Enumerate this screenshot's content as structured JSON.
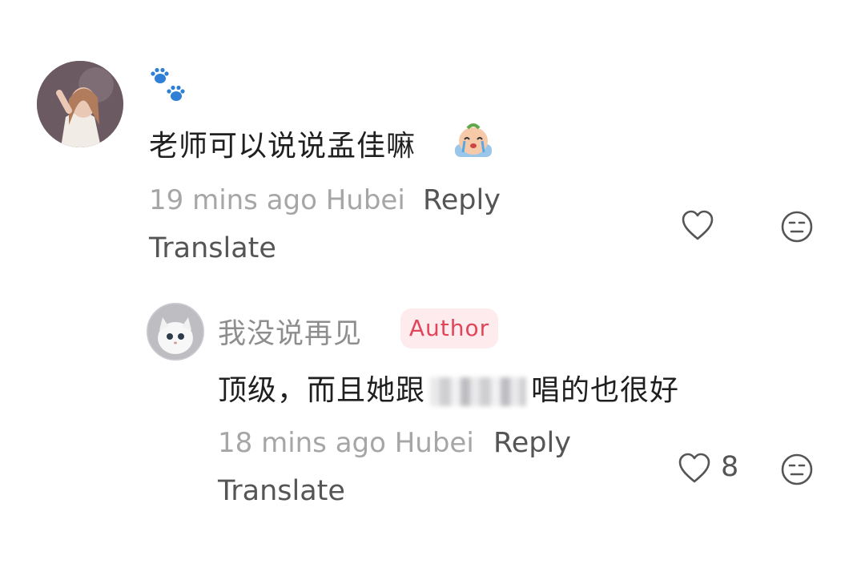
{
  "comments": [
    {
      "username": "🐾",
      "text": "老师可以说说孟佳嘛",
      "time_location": "19 mins ago Hubei",
      "reply_label": "Reply",
      "translate_label": "Translate",
      "like_count": "",
      "icons": {
        "like": "heart-icon",
        "react": "emoji-reaction-icon",
        "emoji": "crying-emoji"
      }
    },
    {
      "username": "我没说再见",
      "badge": "Author",
      "text_before": "顶级，而且她跟",
      "text_after": "唱的也很好",
      "time_location": "18 mins ago Hubei",
      "reply_label": "Reply",
      "translate_label": "Translate",
      "like_count": "8",
      "icons": {
        "like": "heart-icon",
        "react": "emoji-reaction-icon"
      }
    }
  ],
  "colors": {
    "badge_bg": "#fdebed",
    "badge_text": "#e0455a",
    "meta": "#a6a6a6",
    "text": "#1f1f1f"
  }
}
